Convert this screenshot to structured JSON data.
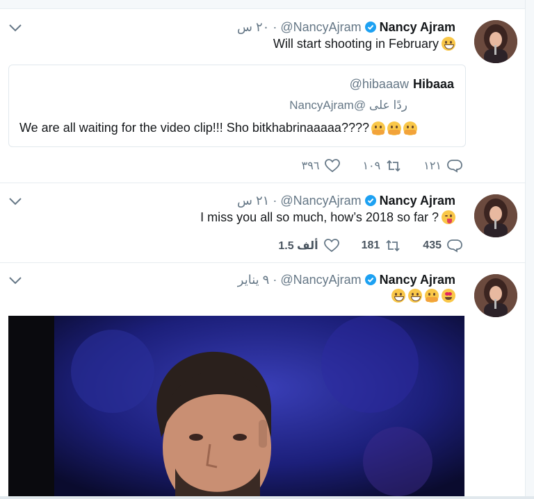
{
  "tweets": [
    {
      "author": "Nancy Ajram",
      "handle": "@NancyAjram",
      "separator": "·",
      "time": "٢٠ س",
      "text": "Will start shooting in February",
      "emojis": [
        "grinning-squinting"
      ],
      "quoted": {
        "author": "Hibaaa",
        "handle": "@hibaaaw",
        "replying_to": "ردًا على @NancyAjram",
        "text": "We are all waiting for the video clip!!! Sho bitkhabrinaaaaa????",
        "emojis": [
          "hugging",
          "hugging",
          "hugging"
        ]
      },
      "actions": {
        "replies": "١٢١",
        "retweets": "١٠٩",
        "likes": "٣٩٦"
      }
    },
    {
      "author": "Nancy Ajram",
      "handle": "@NancyAjram",
      "separator": "·",
      "time": "٢١ س",
      "text": "I miss you all so much, how’s 2018 so far ?",
      "emojis": [
        "winking-tongue"
      ],
      "actions": {
        "replies": "435",
        "retweets": "181",
        "likes": "1.5 ألف"
      }
    },
    {
      "author": "Nancy Ajram",
      "handle": "@NancyAjram",
      "separator": "·",
      "time": "٩ يناير",
      "text": "",
      "emojis": [
        "grinning-squinting",
        "grinning-squinting",
        "hugging",
        "heart-eyes"
      ]
    }
  ],
  "colors": {
    "verified": "#1da1f2",
    "secondary_text": "#657786",
    "border": "#e6ecf0"
  }
}
